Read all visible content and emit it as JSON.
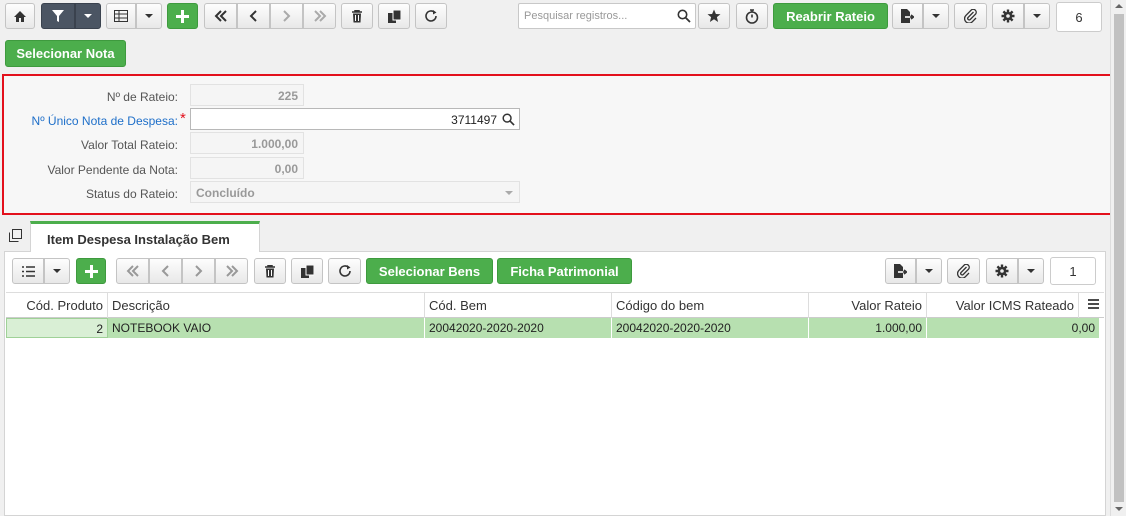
{
  "toolbar": {
    "search_placeholder": "Pesquisar registros...",
    "reopen_label": "Reabrir Rateio",
    "page_count": "6"
  },
  "select_note_label": "Selecionar Nota",
  "form": {
    "rateio_no_label": "Nº de Rateio:",
    "rateio_no_value": "225",
    "unique_note_label": "Nº Único Nota de Despesa:",
    "unique_note_value": "3711497",
    "total_label": "Valor Total Rateio:",
    "total_value": "1.000,00",
    "pending_label": "Valor Pendente da Nota:",
    "pending_value": "0,00",
    "status_label": "Status do Rateio:",
    "status_value": "Concluído",
    "required_mark": "*"
  },
  "tab": {
    "label": "Item Despesa Instalação Bem"
  },
  "sub_toolbar": {
    "select_assets_label": "Selecionar Bens",
    "asset_sheet_label": "Ficha Patrimonial",
    "page_count": "1"
  },
  "grid": {
    "columns": [
      "Cód. Produto",
      "Descrição",
      "Cód. Bem",
      "Código do bem",
      "Valor Rateio",
      "Valor ICMS Rateado"
    ],
    "rows": [
      [
        "2",
        "NOTEBOOK VAIO",
        "20042020-2020-2020",
        "20042020-2020-2020",
        "1.000,00",
        "0,00"
      ]
    ]
  },
  "colors": {
    "accent_green": "#4cae4c",
    "highlight_red": "#e3101c",
    "selected_row": "#b7e0b0",
    "link_blue": "#1e6fc9"
  }
}
